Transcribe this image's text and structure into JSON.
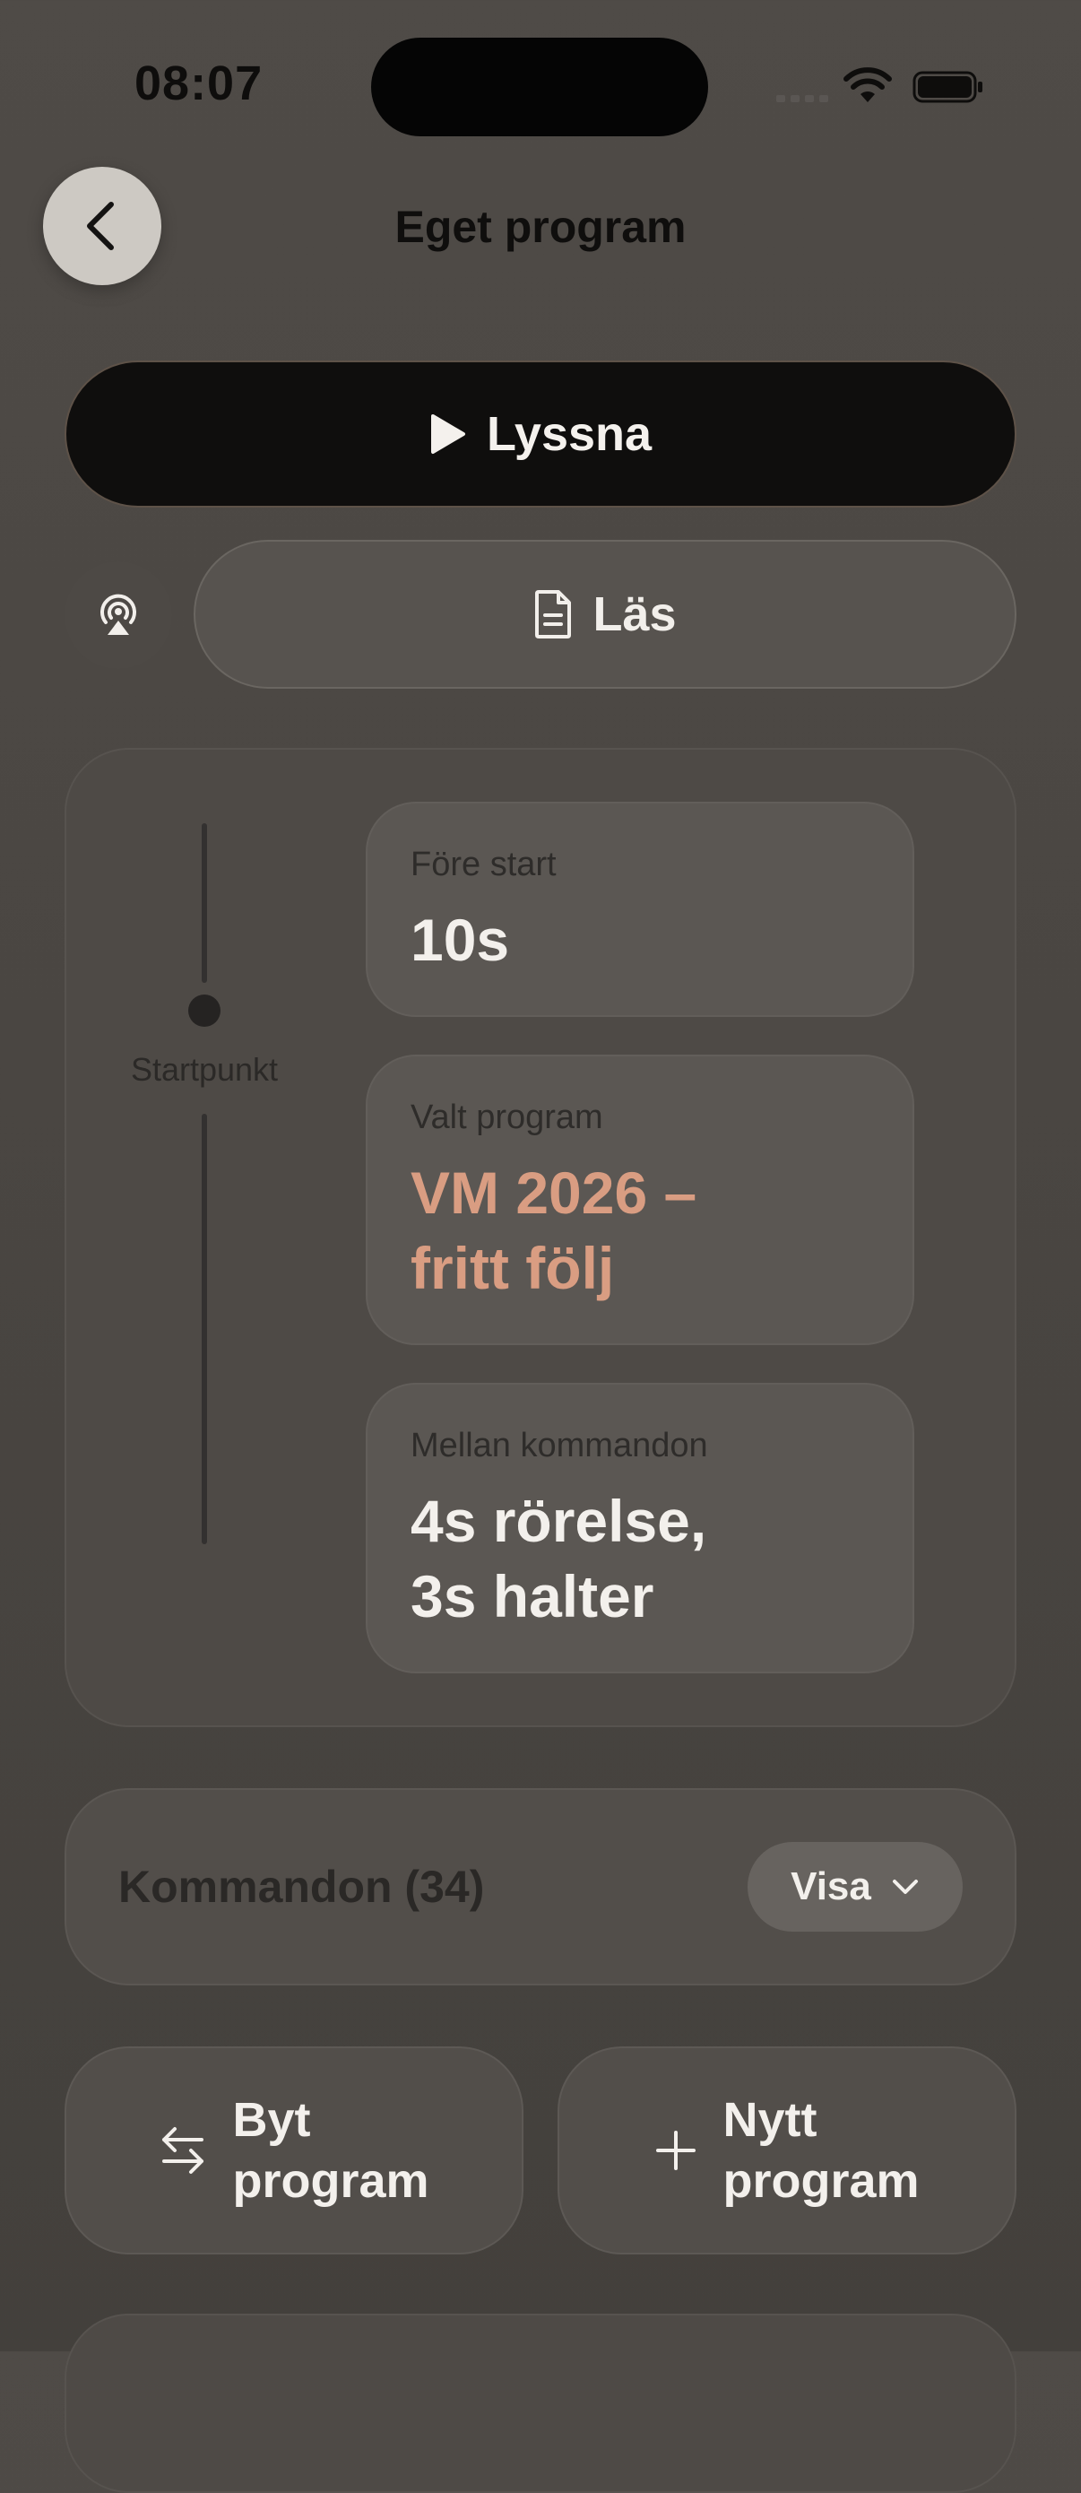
{
  "status_bar": {
    "time": "08:07"
  },
  "nav": {
    "title": "Eget program",
    "back_icon": "chevron-left-icon"
  },
  "actions": {
    "listen_label": "Lyssna",
    "listen_icon": "play-icon",
    "read_label": "Läs",
    "read_icon": "document-icon",
    "airplay_icon": "airplay-audio-icon"
  },
  "timeline": {
    "label": "Startpunkt"
  },
  "settings": [
    {
      "label": "Före start",
      "value": "10s"
    },
    {
      "label": "Valt program",
      "value": "VM 2026 –\nfritt följ"
    },
    {
      "label": "Mellan kommandon",
      "value": "4s rörelse,\n3s halter"
    }
  ],
  "commands": {
    "title": "Kommandon (34)",
    "toggle_label": "Visa"
  },
  "bottom_actions": {
    "switch_label": "Byt\nprogram",
    "new_label": "Nytt\nprogram"
  },
  "colors": {
    "background": "#4a4642",
    "accent": "#d99d82",
    "primary_button": "#0f0e0d"
  }
}
